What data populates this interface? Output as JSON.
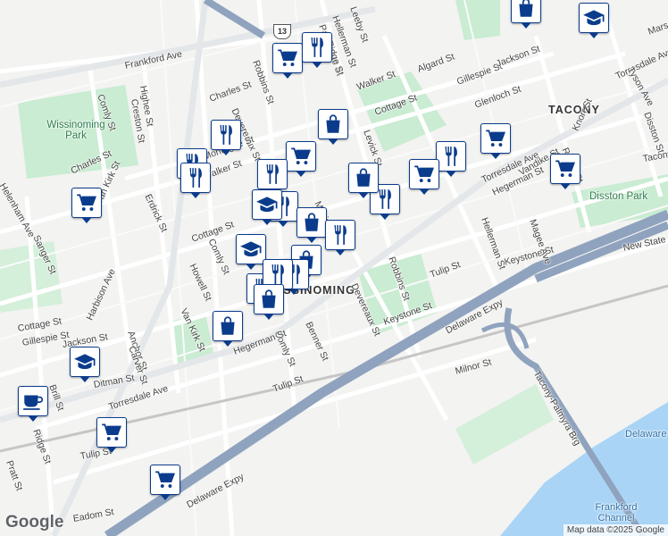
{
  "map": {
    "attribution": "Map data ©2025 Google",
    "logo": "Google",
    "highway_shield": "13",
    "colors": {
      "land": "#f3f3f1",
      "park": "#c9ecd2",
      "water": "#a9d4f5",
      "highway": "#8fa3be",
      "pin_border": "#0b3c8c",
      "pin_icon": "#0b3c8c"
    }
  },
  "neighborhoods": [
    "TACONY",
    "WISSINOMING"
  ],
  "parks": [
    "Wissinoming Park",
    "Disston Park"
  ],
  "water_labels": [
    "Frankford Channel",
    "Delaware Riv"
  ],
  "highways": [
    "Delaware Expy",
    "Delaware Expy",
    "Tacony-Palmyra Brg",
    "New State"
  ],
  "streets": [
    "Frankford Ave",
    "Robbins St",
    "Passmore St",
    "Hellerman St",
    "Leeby St",
    "Ridge St",
    "Algard St",
    "Walker St",
    "Gillespie St",
    "Jackson St",
    "Cottage St",
    "Glenloch St",
    "Torresdale Ave",
    "Comly St",
    "Highee St",
    "Creston St",
    "Charles St",
    "Devereaux St",
    "Erdrick St",
    "Montague St",
    "Walker St",
    "Van Kirk St",
    "Cottage St",
    "Comly St",
    "Howell St",
    "Van Kirk St",
    "Torresdale Ave",
    "Levick St",
    "Robbins St",
    "Mckinley St",
    "Devereaux St",
    "Benner St",
    "Comly St",
    "Hegerman St",
    "Tulip St",
    "Keystone St",
    "Tulip St",
    "Keystone St",
    "Hellerman St",
    "Vandike St",
    "Hegerman St",
    "Knorr St",
    "Rawle St",
    "Magee Ave",
    "Milnor St",
    "Cottage St",
    "Gillespie St",
    "Jackson St",
    "Harbison Ave",
    "Anchor St",
    "Carver St",
    "Ditman St",
    "Brill St",
    "Ridge St",
    "Pratt St",
    "Tulip St",
    "Eadom St",
    "Sanger St",
    "Charles St",
    "Helenham Ave",
    "Marsden St",
    "Torresdale Ave",
    "Tyson Ave",
    "Disston St",
    "Tacony St"
  ],
  "pins": [
    {
      "type": "shopping-cart"
    },
    {
      "type": "restaurant"
    },
    {
      "type": "graduation-cap"
    },
    {
      "type": "shopping-bag"
    },
    {
      "type": "restaurant"
    },
    {
      "type": "shopping-cart"
    },
    {
      "type": "restaurant"
    },
    {
      "type": "shopping-cart"
    },
    {
      "type": "restaurant"
    },
    {
      "type": "shopping-cart"
    },
    {
      "type": "restaurant"
    },
    {
      "type": "restaurant"
    },
    {
      "type": "shopping-bag"
    },
    {
      "type": "restaurant"
    },
    {
      "type": "shopping-bag"
    },
    {
      "type": "restaurant"
    },
    {
      "type": "graduation-cap"
    },
    {
      "type": "shopping-bag"
    },
    {
      "type": "restaurant"
    },
    {
      "type": "graduation-cap"
    },
    {
      "type": "shopping-bag"
    },
    {
      "type": "restaurant"
    },
    {
      "type": "restaurant"
    },
    {
      "type": "restaurant"
    },
    {
      "type": "shopping-bag"
    },
    {
      "type": "shopping-bag"
    },
    {
      "type": "graduation-cap"
    },
    {
      "type": "coffee-cup"
    },
    {
      "type": "shopping-cart"
    },
    {
      "type": "shopping-cart"
    },
    {
      "type": "shopping-cart"
    },
    {
      "type": "shopping-cart"
    }
  ]
}
